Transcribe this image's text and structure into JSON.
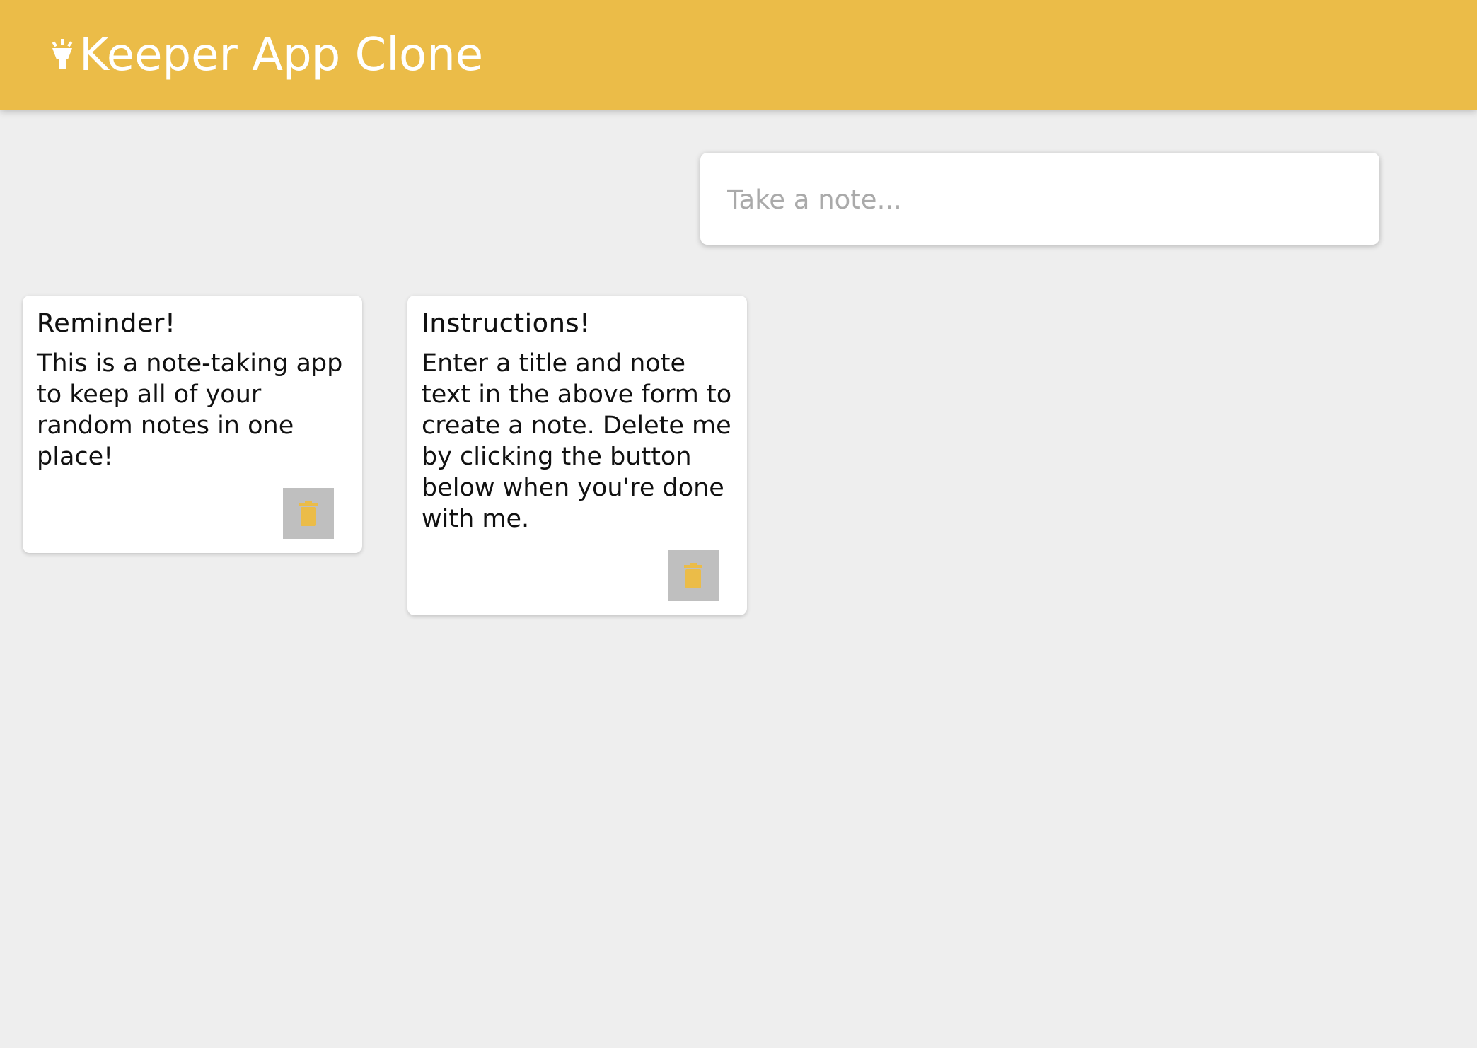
{
  "header": {
    "title": "Keeper App Clone",
    "icon": "highlight-lamp-icon",
    "background_color": "#ebbc48"
  },
  "create_note": {
    "placeholder": "Take a note..."
  },
  "notes": [
    {
      "title": "Reminder!",
      "content": "This is a note-taking app to keep all of your random notes in one place!",
      "delete_icon": "trash-icon"
    },
    {
      "title": "Instructions!",
      "content": "Enter a title and note text in the above form to create a note. Delete me by clicking the button below when you're done with me.",
      "delete_icon": "trash-icon"
    }
  ],
  "colors": {
    "accent": "#ebbc48",
    "page_background": "#eeeeee",
    "delete_button": "#bfbfbf"
  }
}
